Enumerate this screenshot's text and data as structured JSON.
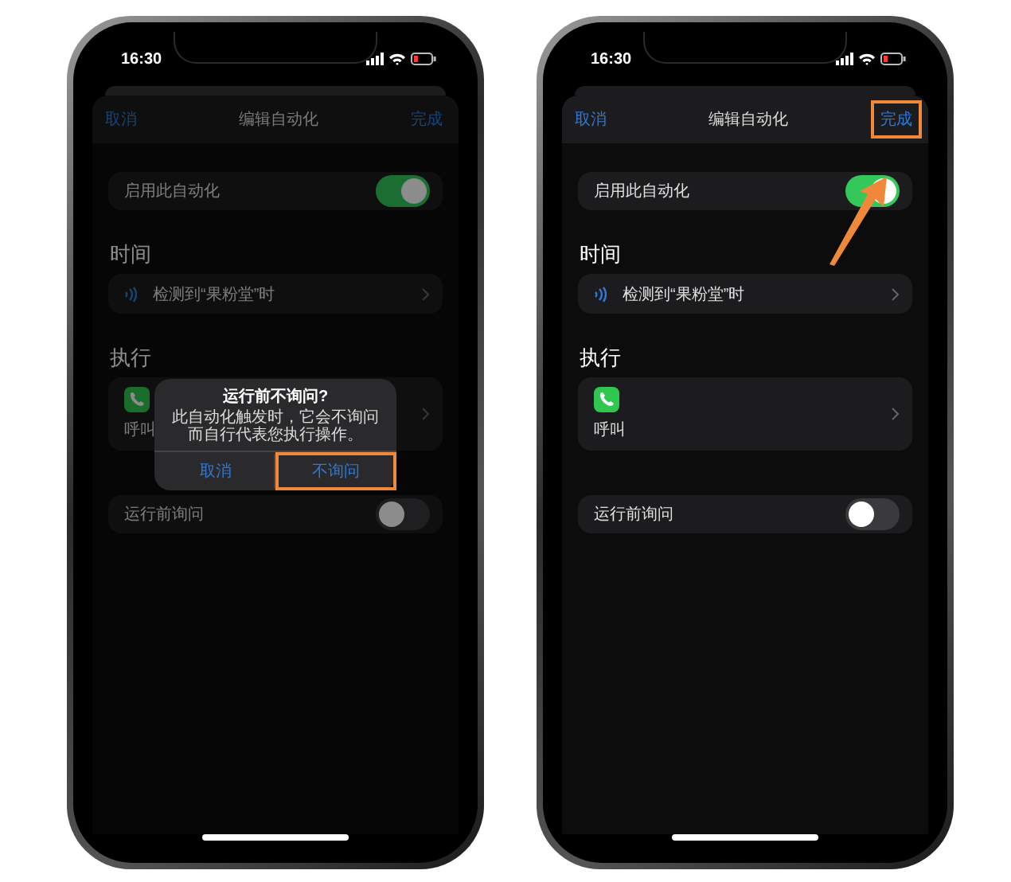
{
  "phones": [
    {
      "status_time": "16:30",
      "nav": {
        "cancel": "取消",
        "title": "编辑自动化",
        "done": {
          "label": "完成",
          "highlighted": false
        }
      },
      "enable_row": {
        "label": "启用此自动化",
        "on": true
      },
      "sections": [
        {
          "header": "时间",
          "kind": "trigger",
          "label": "检测到“果粉堂”时"
        },
        {
          "header": "执行",
          "kind": "action",
          "label": "呼叫"
        }
      ],
      "ask_row": {
        "label": "运行前询问",
        "on": false
      },
      "alert": {
        "title": "运行前不询问?",
        "message": "此自动化触发时，它会不询问而自行代表您执行操作。",
        "buttons": [
          {
            "label": "取消",
            "highlighted": false
          },
          {
            "label": "不询问",
            "highlighted": true
          }
        ]
      },
      "pointer_arrow": false
    },
    {
      "status_time": "16:30",
      "nav": {
        "cancel": "取消",
        "title": "编辑自动化",
        "done": {
          "label": "完成",
          "highlighted": true
        }
      },
      "enable_row": {
        "label": "启用此自动化",
        "on": true
      },
      "sections": [
        {
          "header": "时间",
          "kind": "trigger",
          "label": "检测到“果粉堂”时"
        },
        {
          "header": "执行",
          "kind": "action",
          "label": "呼叫"
        }
      ],
      "ask_row": {
        "label": "运行前询问",
        "on": false
      },
      "pointer_arrow": true
    }
  ]
}
